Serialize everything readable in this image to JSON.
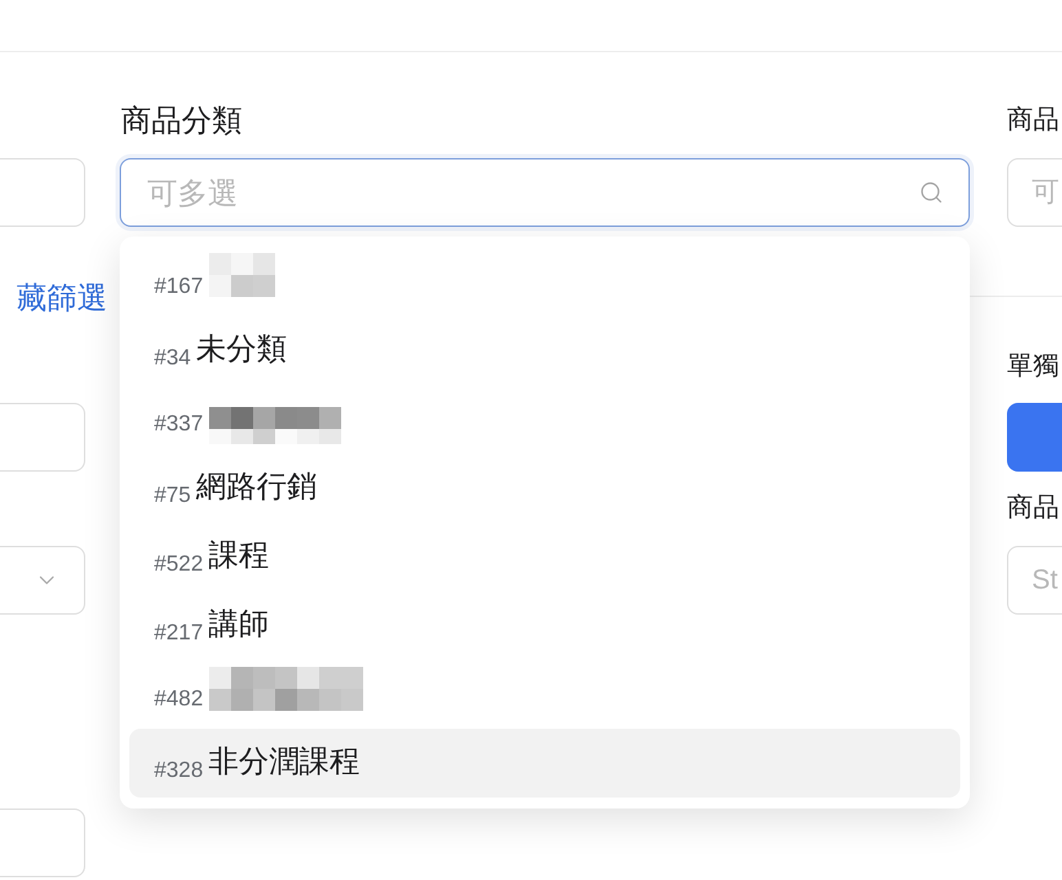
{
  "left_column": {
    "fields": [
      {
        "kind": "input"
      },
      {
        "kind": "link",
        "text": "藏篩選"
      },
      {
        "kind": "input"
      },
      {
        "kind": "select"
      },
      {
        "kind": "input"
      }
    ]
  },
  "category_filter": {
    "label": "商品分類",
    "placeholder": "可多選",
    "focused": true,
    "options": [
      {
        "id": "#167",
        "redacted": true,
        "highlighted": false
      },
      {
        "id": "#34",
        "name": "未分類",
        "redacted": false,
        "highlighted": false
      },
      {
        "id": "#337",
        "redacted": true,
        "highlighted": false
      },
      {
        "id": "#75",
        "name": "網路行銷",
        "redacted": false,
        "highlighted": false
      },
      {
        "id": "#522",
        "name": "課程",
        "redacted": false,
        "highlighted": false
      },
      {
        "id": "#217",
        "name": "講師",
        "redacted": false,
        "highlighted": false
      },
      {
        "id": "#482",
        "redacted": true,
        "highlighted": false
      },
      {
        "id": "#328",
        "name": "非分潤課程",
        "redacted": false,
        "highlighted": true
      }
    ]
  },
  "right_column": {
    "items": [
      {
        "kind": "label",
        "text": "商品"
      },
      {
        "kind": "input",
        "placeholder": "可"
      },
      {
        "kind": "divider"
      },
      {
        "kind": "label",
        "text": "單獨"
      },
      {
        "kind": "button"
      },
      {
        "kind": "label",
        "text": "商品"
      },
      {
        "kind": "input",
        "placeholder": "St"
      }
    ]
  }
}
